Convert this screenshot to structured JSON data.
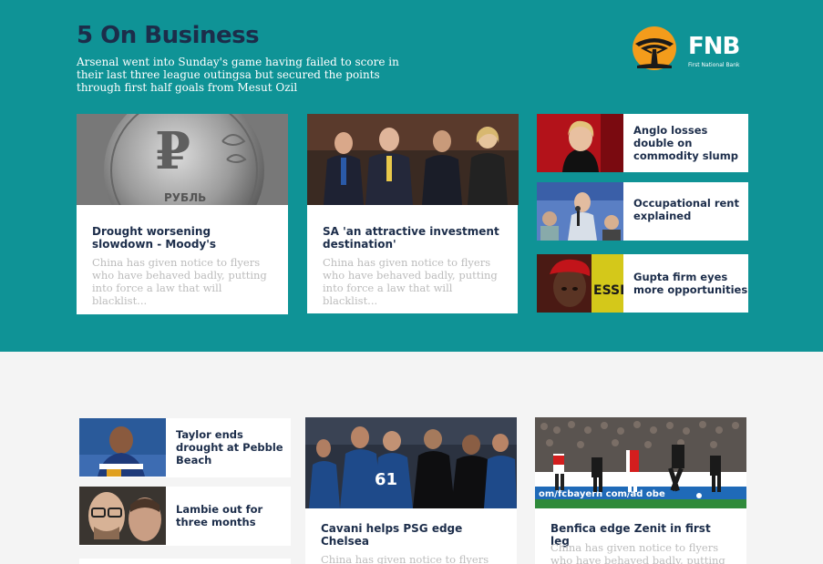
{
  "header": {
    "title": "5 On Business",
    "subtitle": "Arsenal went into Sunday's game having failed to score in their last three league outingsa but secured the points through first half goals from Mesut Ozil",
    "brand_name": "FNB",
    "brand_tagline": "First National Bank"
  },
  "top_cards": [
    {
      "title": "Drought worsening slowdown - Moody's",
      "excerpt": "China has given notice to flyers who have behaved badly, putting into force a law that will blacklist...",
      "image": "ruble-coin-photo"
    },
    {
      "title": "SA 'an attractive investment destination'",
      "excerpt": "China has given notice to flyers who have behaved badly, putting into force a law that will blacklist...",
      "image": "officials-meeting-photo"
    }
  ],
  "top_side": [
    {
      "title": "Anglo losses double on commodity slump",
      "image": "woman-speaking-photo"
    },
    {
      "title": "Occupational rent explained",
      "image": "man-microphone-photo"
    },
    {
      "title": "Gupta firm eyes more opportunities",
      "image": "man-red-beret-photo"
    }
  ],
  "bottom_side": [
    {
      "title": "Taylor ends drought at Pebble Beach",
      "image": "rugby-player-photo"
    },
    {
      "title": "Lambie out for three months",
      "image": "man-glasses-photo"
    }
  ],
  "bottom_cards": [
    {
      "title": "Cavani helps PSG edge Chelsea",
      "excerpt": "China has given notice to flyers who",
      "image": "rugby-team-huddle-photo"
    },
    {
      "title": "Benfica edge Zenit in first leg",
      "excerpt": "China has given notice to flyers who have behaved badly, putting into",
      "image": "football-match-photo"
    }
  ],
  "colors": {
    "hero_bg": "#0f9396",
    "title_dark": "#1c2d4a",
    "excerpt_grey": "#bcbcbc",
    "brand_orange": "#f39c1b"
  }
}
